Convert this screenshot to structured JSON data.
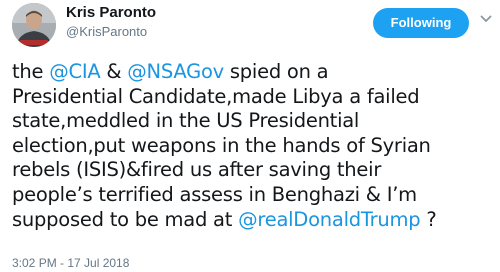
{
  "user": {
    "name": "Kris Paronto",
    "handle": "@KrisParonto",
    "avatar_icon": "profile-photo"
  },
  "follow_button": {
    "label": "Following",
    "color": "#1da1f2"
  },
  "menu": {
    "icon": "chevron-down-icon"
  },
  "tweet": {
    "lines": [
      [
        {
          "text": "the "
        },
        {
          "text": "@CIA",
          "mention": true
        },
        {
          "text": " & "
        },
        {
          "text": "@NSAGov",
          "mention": true
        },
        {
          "text": " spied on a"
        }
      ],
      [
        {
          "text": "Presidential Candidate,made Libya a failed"
        }
      ],
      [
        {
          "text": "state,meddled in the US Presidential"
        }
      ],
      [
        {
          "text": "election,put weapons in the hands of Syrian"
        }
      ],
      [
        {
          "text": "rebels (ISIS)&fired us after saving their"
        }
      ],
      [
        {
          "text": "people’s terrified assess in Benghazi & I’m"
        }
      ],
      [
        {
          "text": "supposed to be mad at "
        },
        {
          "text": "@realDonaldTrump",
          "mention": true
        },
        {
          "text": " ?"
        }
      ]
    ],
    "mention_color": "#1b95e0"
  },
  "timestamp": "3:02 PM - 17 Jul 2018"
}
